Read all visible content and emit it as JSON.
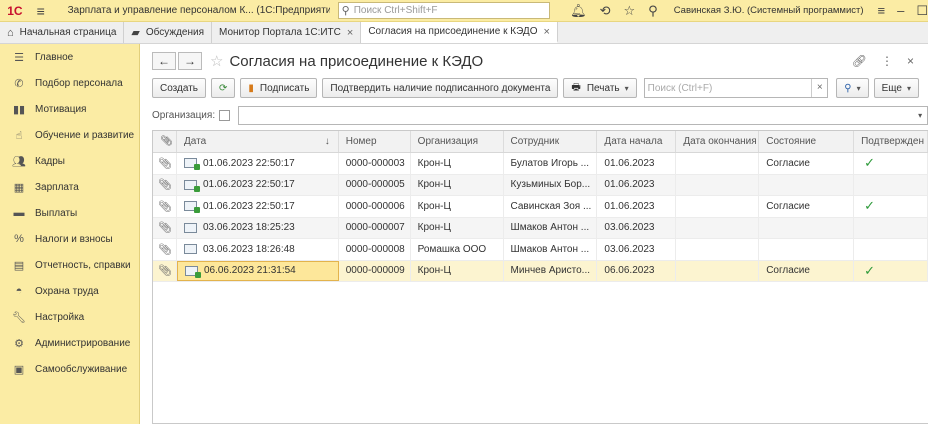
{
  "titlebar": {
    "logo": "1С",
    "app_title": "Зарплата и управление персоналом К... (1С:Предприятие)",
    "search_placeholder": "Поиск Ctrl+Shift+F",
    "user": "Савинская З.Ю. (Системный программист)"
  },
  "tabs": [
    {
      "label": "Начальная страница",
      "icon": "home-icon"
    },
    {
      "label": "Обсуждения",
      "icon": "chat-icon"
    },
    {
      "label": "Монитор Портала 1С:ИТС",
      "close": "×"
    },
    {
      "label": "Согласия на присоединение к КЭДО",
      "close": "×",
      "active": true
    }
  ],
  "sidebar": {
    "items": [
      {
        "label": "Главное",
        "icon": "menu-lines-icon"
      },
      {
        "label": "Подбор персонала",
        "icon": "phone-icon"
      },
      {
        "label": "Мотивация",
        "icon": "motivation-icon"
      },
      {
        "label": "Обучение и развитие",
        "icon": "thumbs-up-icon"
      },
      {
        "label": "Кадры",
        "icon": "people-icon"
      },
      {
        "label": "Зарплата",
        "icon": "calculator-icon"
      },
      {
        "label": "Выплаты",
        "icon": "card-icon"
      },
      {
        "label": "Налоги и взносы",
        "icon": "percent-icon"
      },
      {
        "label": "Отчетность, справки",
        "icon": "report-icon"
      },
      {
        "label": "Охрана труда",
        "icon": "helmet-icon"
      },
      {
        "label": "Настройка",
        "icon": "wrench-icon"
      },
      {
        "label": "Администрирование",
        "icon": "gear-icon"
      },
      {
        "label": "Самообслуживание",
        "icon": "self-service-icon"
      }
    ]
  },
  "form": {
    "title": "Согласия на присоединение к КЭДО",
    "toolbar": {
      "create": "Создать",
      "sign": "Подписать",
      "confirm": "Подтвердить наличие подписанного документа",
      "print": "Печать",
      "search_placeholder": "Поиск (Ctrl+F)",
      "more": "Еще"
    },
    "org_label": "Организация:"
  },
  "table": {
    "columns": [
      "Дата",
      "Номер",
      "Организация",
      "Сотрудник",
      "Дата начала",
      "Дата окончания",
      "Состояние",
      "Подтвержден"
    ],
    "rows": [
      {
        "date": "01.06.2023 22:50:17",
        "number": "0000-000003",
        "org": "Крон-Ц",
        "employee": "Булатов Игорь ...",
        "start": "01.06.2023",
        "end": "",
        "state": "Согласие",
        "confirmed": "✓",
        "signed": true
      },
      {
        "date": "01.06.2023 22:50:17",
        "number": "0000-000005",
        "org": "Крон-Ц",
        "employee": "Кузьминых Бор...",
        "start": "01.06.2023",
        "end": "",
        "state": "",
        "confirmed": "",
        "signed": true
      },
      {
        "date": "01.06.2023 22:50:17",
        "number": "0000-000006",
        "org": "Крон-Ц",
        "employee": "Савинская Зоя ...",
        "start": "01.06.2023",
        "end": "",
        "state": "Согласие",
        "confirmed": "✓",
        "signed": true
      },
      {
        "date": "03.06.2023 18:25:23",
        "number": "0000-000007",
        "org": "Крон-Ц",
        "employee": "Шмаков Антон ...",
        "start": "03.06.2023",
        "end": "",
        "state": "",
        "confirmed": "",
        "signed": false
      },
      {
        "date": "03.06.2023 18:26:48",
        "number": "0000-000008",
        "org": "Ромашка ООО",
        "employee": "Шмаков Антон ...",
        "start": "03.06.2023",
        "end": "",
        "state": "",
        "confirmed": "",
        "signed": false
      },
      {
        "date": "06.06.2023 21:31:54",
        "number": "0000-000009",
        "org": "Крон-Ц",
        "employee": "Минчев Аристо...",
        "start": "06.06.2023",
        "end": "",
        "state": "Согласие",
        "confirmed": "✓",
        "signed": true,
        "selected": true
      }
    ]
  }
}
